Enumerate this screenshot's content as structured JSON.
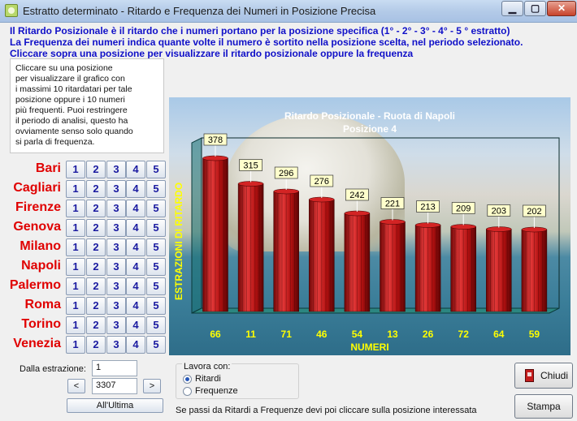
{
  "window": {
    "title": "Estratto determinato - Ritardo e Frequenza dei Numeri in Posizione Precisa"
  },
  "instructions": [
    "Il Ritardo Posizionale è il ritardo che i  numeri portano per la posizione specifica (1° - 2°  - 3° - 4° - 5 ° estratto)",
    "La Frequenza dei numeri indica quante volte il numero è sortito nella posizione scelta, nel periodo selezionato.",
    "Cliccare sopra una posizione per visualizzare il ritardo posizionale oppure la frequenza"
  ],
  "help_text": "Cliccare su una posizione\nper visualizzare il grafico con\ni massimi 10 ritardatari per tale\nposizione oppure i 10 numeri\npiù frequenti. Puoi restringere\nil periodo di analisi, questo ha\novviamente senso solo quando\nsi parla di frequenza.",
  "cities": [
    "Bari",
    "Cagliari",
    "Firenze",
    "Genova",
    "Milano",
    "Napoli",
    "Palermo",
    "Roma",
    "Torino",
    "Venezia"
  ],
  "positions": [
    "1",
    "2",
    "3",
    "4",
    "5"
  ],
  "range": {
    "label": "Dalla estrazione:",
    "from_value": "1",
    "to_value": "3307",
    "prev_label": "<",
    "next_label": ">",
    "last_button": "All'Ultima"
  },
  "mode": {
    "label": "Lavora con:",
    "options": [
      "Ritardi",
      "Frequenze"
    ],
    "selected": "Ritardi"
  },
  "hint": "Se passi da Ritardi a Frequenze devi  poi  cliccare sulla posizione interessata",
  "buttons": {
    "close": "Chiudi",
    "print": "Stampa"
  },
  "colors": {
    "bar": "#b01010",
    "bar_highlight": "#e53a3a",
    "axis_text": "#ffff00",
    "title_text": "#ffffff",
    "instruction_text": "#1010c8",
    "city_text": "#e00000"
  },
  "chart_data": {
    "type": "bar",
    "title": "Ritardo Posizionale - Ruota di Napoli",
    "subtitle": "Posizione 4",
    "xlabel": "NUMERI",
    "ylabel": "ESTRAZIONI DI RITARDO",
    "categories": [
      "66",
      "11",
      "71",
      "46",
      "54",
      "13",
      "26",
      "72",
      "64",
      "59"
    ],
    "values": [
      378,
      315,
      296,
      276,
      242,
      221,
      213,
      209,
      203,
      202
    ],
    "ylim": [
      0,
      400
    ],
    "grid": false,
    "legend": "none"
  }
}
